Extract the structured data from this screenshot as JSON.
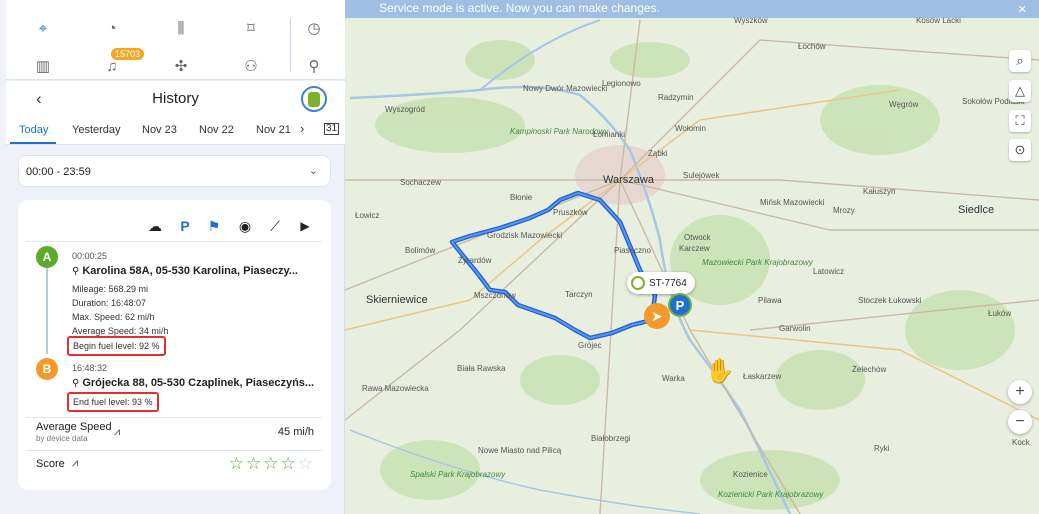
{
  "banner": {
    "text": "Service mode is active. Now you can make changes.",
    "close_icon": "close-icon"
  },
  "nav": {
    "top_icons": [
      "location-pin-icon",
      "speedometer-icon",
      "bar-chart-icon",
      "geofence-icon",
      "clock-dial-icon"
    ],
    "bottom_icons": [
      "building-icon",
      "bell-icon",
      "puzzle-icon",
      "people-icon",
      "pushpin-icon"
    ],
    "alert_count": "15703"
  },
  "history": {
    "title": "History",
    "tabs": [
      "Today",
      "Yesterday",
      "Nov 23",
      "Nov 22",
      "Nov 21"
    ],
    "active_tab": "Today",
    "time_range": "00:00 - 23:59"
  },
  "trip": {
    "toolbar_icons": [
      "cloud-download-icon",
      "parking-icon",
      "checkered-flag-icon",
      "play-circle-icon",
      "route-line-icon",
      "play-icon"
    ],
    "start": {
      "badge": "A",
      "time": "00:00:25",
      "address": "Karolina 58A, 05-530 Karolina, Piaseczy...",
      "mileage": "Mileage: 568.29 mi",
      "duration": "Duration: 16:48:07",
      "max_speed": "Max. Speed: 62 mi/h",
      "avg_speed": "Average Speed: 34 mi/h",
      "fuel": "Begin fuel level: 92 %"
    },
    "end": {
      "badge": "B",
      "time": "16:48:32",
      "address": "Grójecka 88, 05-530 Czaplinek, Piaseczyńs...",
      "fuel": "End fuel level: 93 %"
    },
    "average_speed_label": "Average Speed",
    "average_speed_sub": "by device data",
    "average_speed_value": "45 mi/h",
    "score_label": "Score",
    "score_stars": 4,
    "score_max": 5
  },
  "map": {
    "vehicle_label": "ST-7764",
    "parking_letter": "P",
    "places": {
      "warszawa": "Warszawa",
      "pruszkow": "Pruszków",
      "piaseczno": "Piaseczno",
      "grodzisk": "Grodzisk Mazowiecki",
      "blonie": "Błonie",
      "zyrardow": "Żyrardów",
      "mszczonow": "Mszczonów",
      "tarczyn": "Tarczyn",
      "grojec": "Grójec",
      "skierniewice": "Skierniewice",
      "sochaczew": "Sochaczew",
      "bolimow": "Bolimów",
      "nowy_dwor": "Nowy Dwór Mazowiecki",
      "legionowo": "Legionowo",
      "wolomin": "Wołomin",
      "zabki": "Ząbki",
      "sulejowek": "Sulejówek",
      "minsk": "Mińsk Mazowiecki",
      "otwock": "Otwock",
      "karczew": "Karczew",
      "garwolin": "Garwolin",
      "siedlce": "Siedlce",
      "wegrow": "Węgrów",
      "sokolow": "Sokołów Podlaski",
      "kaluszyn": "Kałuszyn",
      "latowicz": "Latowicz",
      "warka": "Warka",
      "kozienice": "Kozienice",
      "bialobrzegi": "Białobrzegi",
      "rawa": "Rawa Mazowiecka",
      "lowicz": "Łowicz",
      "pilawa": "Pilawa",
      "lomianki": "Łomianki",
      "radzymin": "Radzymin",
      "lukow": "Łuków",
      "stoczek": "Stoczek Łukowski",
      "wyszogrod": "Wyszogród",
      "mrozy": "Mrozy",
      "zelechow": "Żelechów",
      "laskarzew": "Łaskarzew",
      "ryki": "Ryki",
      "kock": "Kock",
      "lochow": "Łochów",
      "nowe_miasto": "Nowe Miasto nad Pilicą",
      "biala_rawska": "Biała Rawska",
      "wyszkow": "Wyszków",
      "kosow": "Kosów Lacki",
      "park_kampinos": "Kampinoski Park Narodowy",
      "park_mazow": "Mazowiecki Park Krajobrazowy",
      "park_kozien": "Kozienicki Park Krajobrazowy",
      "park_spala": "Spalski Park Krajobrazowy"
    },
    "controls": [
      "search-icon",
      "compass-icon",
      "fullscreen-icon",
      "my-location-icon"
    ],
    "zoom_in": "+",
    "zoom_out": "−"
  }
}
